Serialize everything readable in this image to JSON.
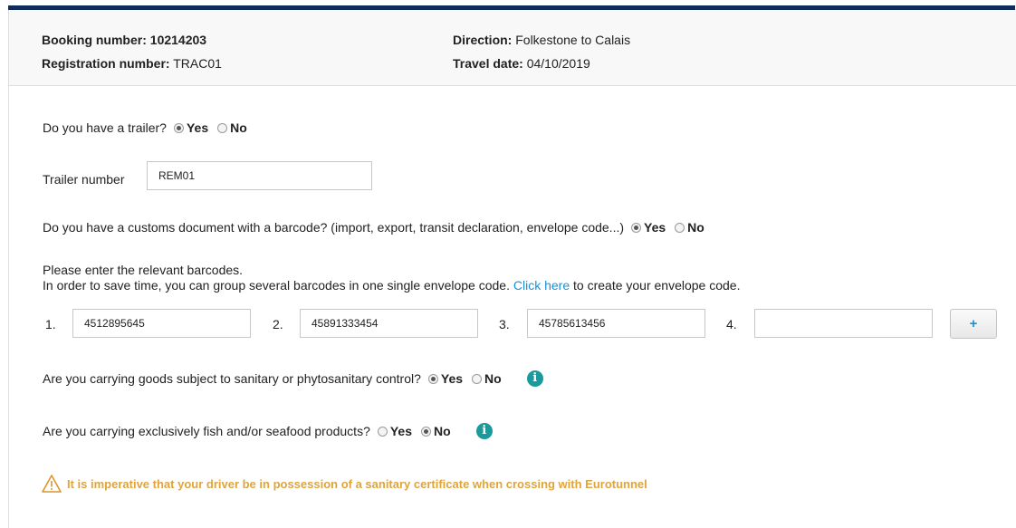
{
  "summary": {
    "booking_label": "Booking number:",
    "booking_value": "10214203",
    "registration_label": "Registration number:",
    "registration_value": "TRAC01",
    "direction_label": "Direction:",
    "direction_value": "Folkestone to Calais",
    "travel_date_label": "Travel date:",
    "travel_date_value": "04/10/2019"
  },
  "trailer_question": {
    "text": "Do you have a trailer?",
    "yes": "Yes",
    "no": "No",
    "selected": "Yes"
  },
  "trailer_number": {
    "label": "Trailer number",
    "value": "REM01"
  },
  "customs_question": {
    "text": "Do you have a customs document with a barcode? (import, export, transit declaration, envelope code...)",
    "yes": "Yes",
    "no": "No",
    "selected": "Yes"
  },
  "barcodes": {
    "intro_line1": "Please enter the relevant barcodes.",
    "intro_line2_before": "In order to save time, you can group several barcodes in one single envelope code.",
    "link_text": "Click here",
    "intro_line2_after": "to create your envelope code.",
    "fields": [
      {
        "label": "1.",
        "value": "4512895645"
      },
      {
        "label": "2.",
        "value": "45891333454"
      },
      {
        "label": "3.",
        "value": "45785613456"
      },
      {
        "label": "4.",
        "value": ""
      }
    ],
    "add_button": "+"
  },
  "sanitary_question": {
    "text": "Are you carrying goods subject to sanitary or phytosanitary control?",
    "yes": "Yes",
    "no": "No",
    "selected": "Yes",
    "info_icon": "info-icon"
  },
  "fish_question": {
    "text": "Are you carrying exclusively fish and/or seafood products?",
    "yes": "Yes",
    "no": "No",
    "selected": "No",
    "info_icon": "info-icon"
  },
  "warning": {
    "icon": "warning-triangle-icon",
    "text": "It is imperative that your driver be in possession of a sanitary certificate when crossing with Eurotunnel"
  },
  "colors": {
    "top_bar": "#0e2b5c",
    "link": "#1a8fd6",
    "info_icon": "#1a9a9a",
    "warning": "#e0a43a"
  }
}
